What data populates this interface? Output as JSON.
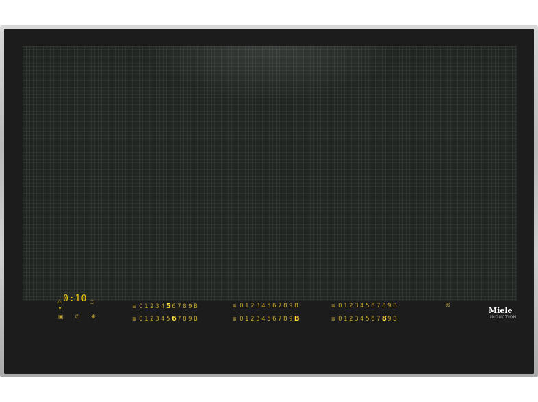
{
  "timer": {
    "display": "0:10"
  },
  "icons": {
    "bell": "bell-icon",
    "clock": "clock-icon",
    "stop": "stop-icon",
    "power": "power-icon",
    "fan": "fan-icon",
    "wifi": "wifi-icon",
    "zone": "zone-icon"
  },
  "zones": [
    {
      "levels": [
        "0",
        "1",
        "2",
        "3",
        "4",
        "5",
        "6",
        "7",
        "8",
        "9",
        "B"
      ],
      "active": 5
    },
    {
      "levels": [
        "0",
        "1",
        "2",
        "3",
        "4",
        "5",
        "6",
        "7",
        "8",
        "9",
        "B"
      ],
      "active": 6
    },
    {
      "levels": [
        "0",
        "1",
        "2",
        "3",
        "4",
        "5",
        "6",
        "7",
        "8",
        "9",
        "B"
      ],
      "active": -1
    },
    {
      "levels": [
        "0",
        "1",
        "2",
        "3",
        "4",
        "5",
        "6",
        "7",
        "8",
        "9",
        "B"
      ],
      "active": 10
    },
    {
      "levels": [
        "0",
        "1",
        "2",
        "3",
        "4",
        "5",
        "6",
        "7",
        "8",
        "9",
        "B"
      ],
      "active": -1
    },
    {
      "levels": [
        "0",
        "1",
        "2",
        "3",
        "4",
        "5",
        "6",
        "7",
        "8",
        "9",
        "B"
      ],
      "active": 8
    }
  ],
  "brand": {
    "logo": "Miele",
    "subtitle": "INDUCTION"
  },
  "colors": {
    "display": "#f0c800",
    "glass": "#1c1c1c",
    "frame": "#c0c0c0"
  }
}
